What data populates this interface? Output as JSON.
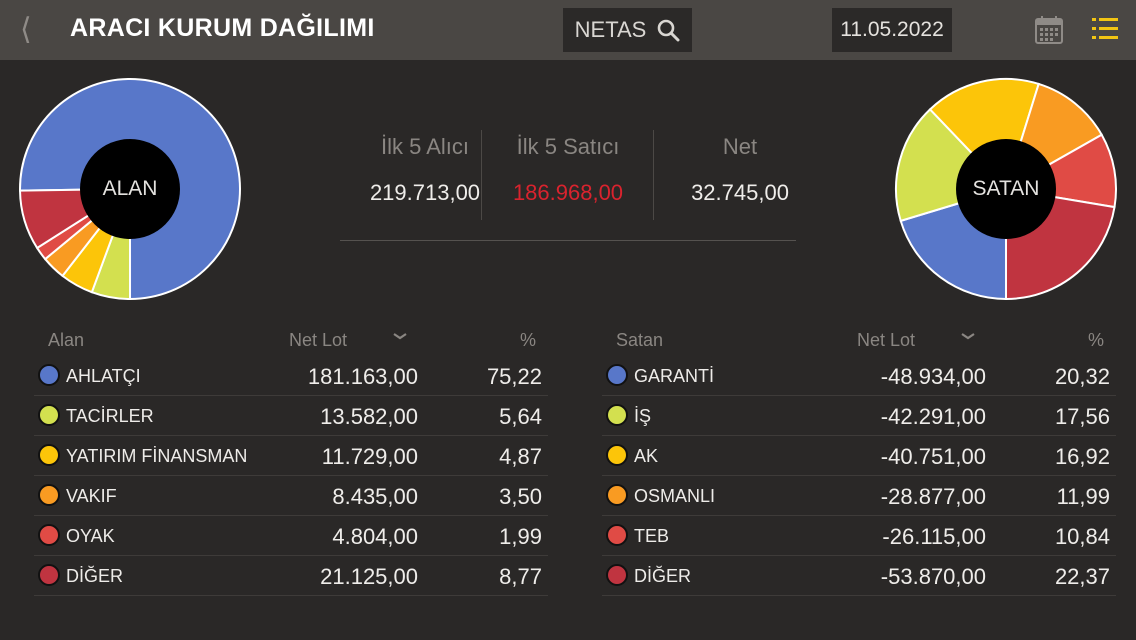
{
  "header": {
    "back_icon": "chevron-left-icon",
    "title": "ARACI KURUM DAĞILIMI",
    "symbol": "NETAS",
    "date": "11.05.2022",
    "calendar_icon": "calendar-icon",
    "menu_icon": "list-icon"
  },
  "colors": {
    "blue": "#5877c9",
    "lime": "#d3e04f",
    "yellow": "#fcc509",
    "orange": "#f99b22",
    "red": "#e04b45",
    "darkred": "#c03440",
    "accent": "#f2c513"
  },
  "pies": {
    "left_label": "ALAN",
    "right_label": "SATAN"
  },
  "summary": {
    "buyers_label": "İlk 5 Alıcı",
    "buyers_value": "219.713,00",
    "sellers_label": "İlk 5 Satıcı",
    "sellers_value": "186.968,00",
    "net_label": "Net",
    "net_value": "32.745,00"
  },
  "buyers": {
    "header_name": "Alan",
    "header_lot": "Net Lot",
    "header_pct": "%",
    "rows": [
      {
        "name": "AHLATÇI",
        "lot": "181.163,00",
        "pct": "75,22",
        "color": "#5877c9"
      },
      {
        "name": "TACİRLER",
        "lot": "13.582,00",
        "pct": "5,64",
        "color": "#d3e04f"
      },
      {
        "name": "YATIRIM FİNANSMAN",
        "lot": "11.729,00",
        "pct": "4,87",
        "color": "#fcc509"
      },
      {
        "name": "VAKIF",
        "lot": "8.435,00",
        "pct": "3,50",
        "color": "#f99b22"
      },
      {
        "name": "OYAK",
        "lot": "4.804,00",
        "pct": "1,99",
        "color": "#e04b45"
      },
      {
        "name": "DİĞER",
        "lot": "21.125,00",
        "pct": "8,77",
        "color": "#c03440"
      }
    ]
  },
  "sellers": {
    "header_name": "Satan",
    "header_lot": "Net Lot",
    "header_pct": "%",
    "rows": [
      {
        "name": "GARANTİ",
        "lot": "-48.934,00",
        "pct": "20,32",
        "color": "#5877c9"
      },
      {
        "name": "İŞ",
        "lot": "-42.291,00",
        "pct": "17,56",
        "color": "#d3e04f"
      },
      {
        "name": "AK",
        "lot": "-40.751,00",
        "pct": "16,92",
        "color": "#fcc509"
      },
      {
        "name": "OSMANLI",
        "lot": "-28.877,00",
        "pct": "11,99",
        "color": "#f99b22"
      },
      {
        "name": "TEB",
        "lot": "-26.115,00",
        "pct": "10,84",
        "color": "#e04b45"
      },
      {
        "name": "DİĞER",
        "lot": "-53.870,00",
        "pct": "22,37",
        "color": "#c03440"
      }
    ]
  }
}
